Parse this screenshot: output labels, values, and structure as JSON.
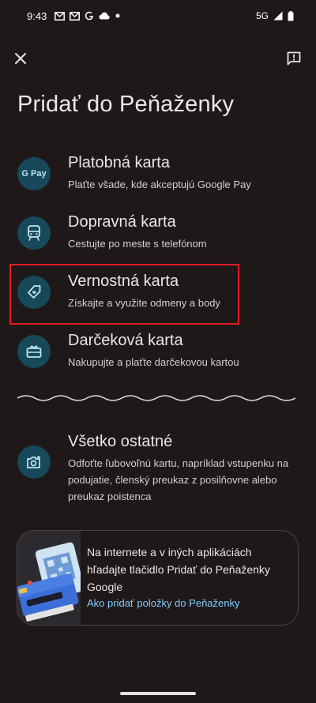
{
  "status_bar": {
    "time": "9:43",
    "network": "5G",
    "icons": [
      "mail-icon",
      "mail-icon",
      "google-icon",
      "cloud-icon",
      "dot-icon",
      "signal-icon",
      "battery-icon"
    ]
  },
  "top_bar": {
    "close_icon": "close-icon",
    "feedback_icon": "feedback-icon"
  },
  "page": {
    "title": "Pridať do Peňaženky"
  },
  "options": [
    {
      "title": "Platobná karta",
      "subtitle": "Plaťte všade, kde akceptujú Google Pay",
      "icon": "google-pay-icon",
      "icon_text": "G Pay"
    },
    {
      "title": "Dopravná karta",
      "subtitle": "Cestujte po meste s telefónom",
      "icon": "train-icon"
    },
    {
      "title": "Vernostná karta",
      "subtitle": "Získajte a využite odmeny a body",
      "icon": "loyalty-tag-icon"
    },
    {
      "title": "Darčeková karta",
      "subtitle": "Nakupujte a plaťte darčekovou kartou",
      "icon": "gift-card-icon"
    },
    {
      "title": "Všetko ostatné",
      "subtitle": "Odfoťte ľubovoľnú kartu, napríklad vstupenku na podujatie, členský preukaz z posilňovne alebo preukaz poistenca",
      "icon": "add-photo-icon"
    }
  ],
  "info_card": {
    "text": "Na internete a v iných aplikáciách hľadajte tlačidlo Pridať do Peňaženky Google",
    "link": "Ako pridať položky do Peňaženky",
    "illustration": "wallet-illustration"
  },
  "colors": {
    "background": "#1f1819",
    "icon_circle": "#17495a",
    "icon_glyph": "#bfe4f2",
    "link": "#7fcfff",
    "highlight": "#e01b22"
  }
}
